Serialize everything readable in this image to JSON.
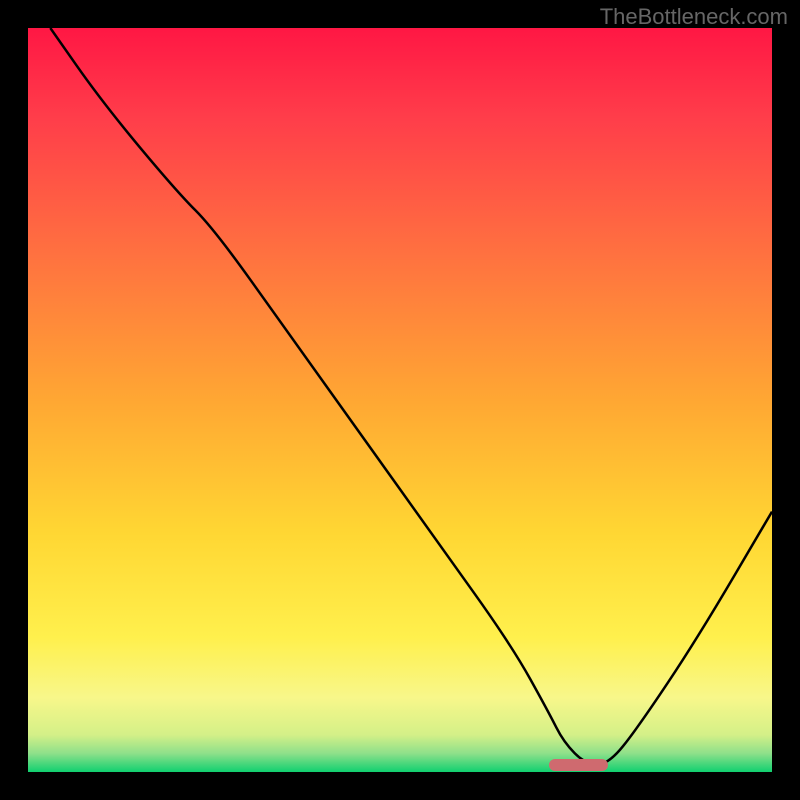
{
  "watermark": "TheBottleneck.com",
  "chart_data": {
    "type": "line",
    "title": "",
    "xlabel": "",
    "ylabel": "",
    "xlim": [
      0,
      100
    ],
    "ylim": [
      0,
      100
    ],
    "x": [
      3,
      10,
      20,
      25,
      35,
      45,
      55,
      65,
      70,
      72,
      75,
      78,
      82,
      90,
      100
    ],
    "y": [
      100,
      90,
      78,
      73,
      59,
      45,
      31,
      17,
      8,
      4,
      1,
      1,
      6,
      18,
      35
    ],
    "gradient_stops": [
      {
        "pos": 0,
        "color": "#ff1744"
      },
      {
        "pos": 0.12,
        "color": "#ff3d4a"
      },
      {
        "pos": 0.3,
        "color": "#ff7040"
      },
      {
        "pos": 0.5,
        "color": "#ffa733"
      },
      {
        "pos": 0.68,
        "color": "#ffd733"
      },
      {
        "pos": 0.82,
        "color": "#fff04d"
      },
      {
        "pos": 0.9,
        "color": "#f8f78a"
      },
      {
        "pos": 0.95,
        "color": "#d4f088"
      },
      {
        "pos": 0.975,
        "color": "#8ee08a"
      },
      {
        "pos": 1.0,
        "color": "#10d070"
      }
    ],
    "marker": {
      "x_start": 70,
      "x_end": 78,
      "y": 1
    }
  }
}
